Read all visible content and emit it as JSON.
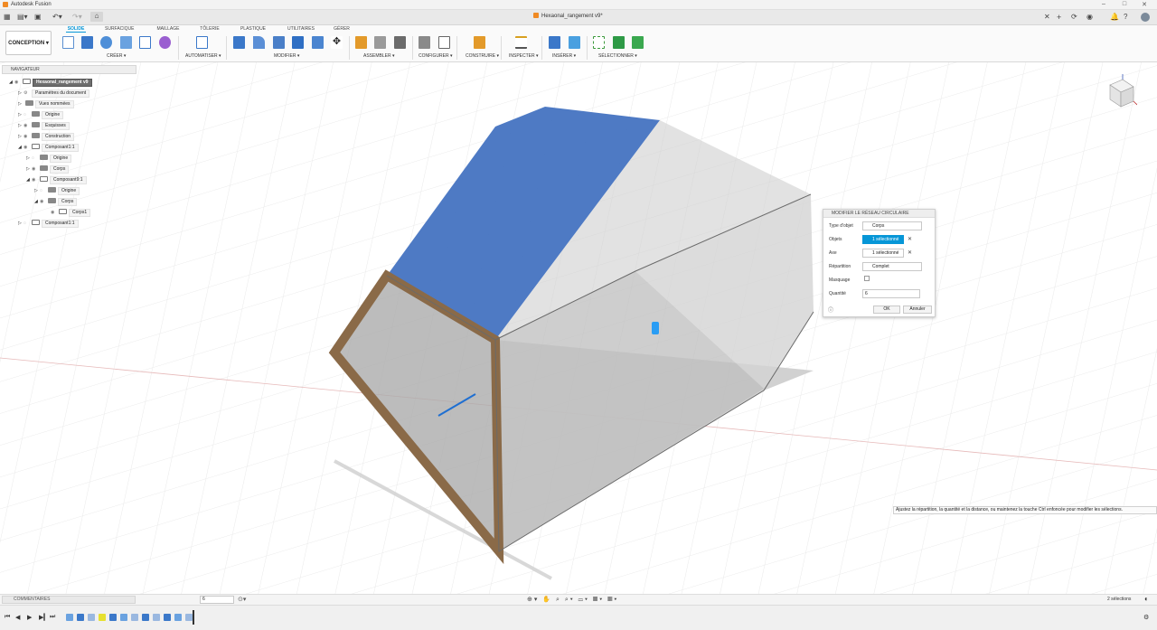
{
  "app": {
    "title": "Autodesk Fusion"
  },
  "document": {
    "tab_title": "Hexaonal_rangement v9*"
  },
  "ribbon": {
    "workspace_label": "CONCEPTION ▾",
    "tabs": [
      "SOLIDE",
      "SURFACIQUE",
      "MAILLAGE",
      "TÔLERIE",
      "PLASTIQUE",
      "UTILITAIRES",
      "GÉRER"
    ],
    "groups": [
      "CRÉER ▾",
      "AUTOMATISER ▾",
      "MODIFIER ▾",
      "ASSEMBLER ▾",
      "CONFIGURER ▾",
      "CONSTRUIRE ▾",
      "INSPECTER ▾",
      "INSÉRER ▾",
      "SÉLECTIONNER ▾"
    ]
  },
  "navigator": {
    "title": "NAVIGATEUR",
    "items": [
      {
        "label": "Hexaonal_rangement v9"
      },
      {
        "label": "Paramètres du document"
      },
      {
        "label": "Vues nommées"
      },
      {
        "label": "Origine"
      },
      {
        "label": "Esquisses"
      },
      {
        "label": "Construction"
      },
      {
        "label": "Composant1:1"
      },
      {
        "label": "Origine"
      },
      {
        "label": "Corps"
      },
      {
        "label": "Composant9:1"
      },
      {
        "label": "Origine"
      },
      {
        "label": "Corps"
      },
      {
        "label": "Corps1"
      },
      {
        "label": "Composant1:1"
      }
    ]
  },
  "dialog": {
    "title": "MODIFIER LE RÉSEAU CIRCULAIRE",
    "object_type_label": "Type d'objet",
    "object_type_value": "Corps",
    "objects_label": "Objets",
    "objects_value": "1 sélectionné",
    "axis_label": "Axe",
    "axis_value": "1 sélectionné",
    "distribution_label": "Répartition",
    "distribution_value": "Complet",
    "suppression_label": "Masquage",
    "quantity_label": "Quantité",
    "quantity_value": "6",
    "ok_label": "OK",
    "cancel_label": "Annuler"
  },
  "tooltip": {
    "text": "Ajustez la répartition, la quantité et la distance, ou maintenez la touche Ctrl enfoncée pour modifier les sélections."
  },
  "bottom": {
    "comments_label": "COMMENTAIRES",
    "counter_value": "6",
    "status": "2 sélections"
  },
  "colors": {
    "accent": "#0696d7",
    "selected_face": "#3f6fbf",
    "wood": "#8a6a48"
  }
}
